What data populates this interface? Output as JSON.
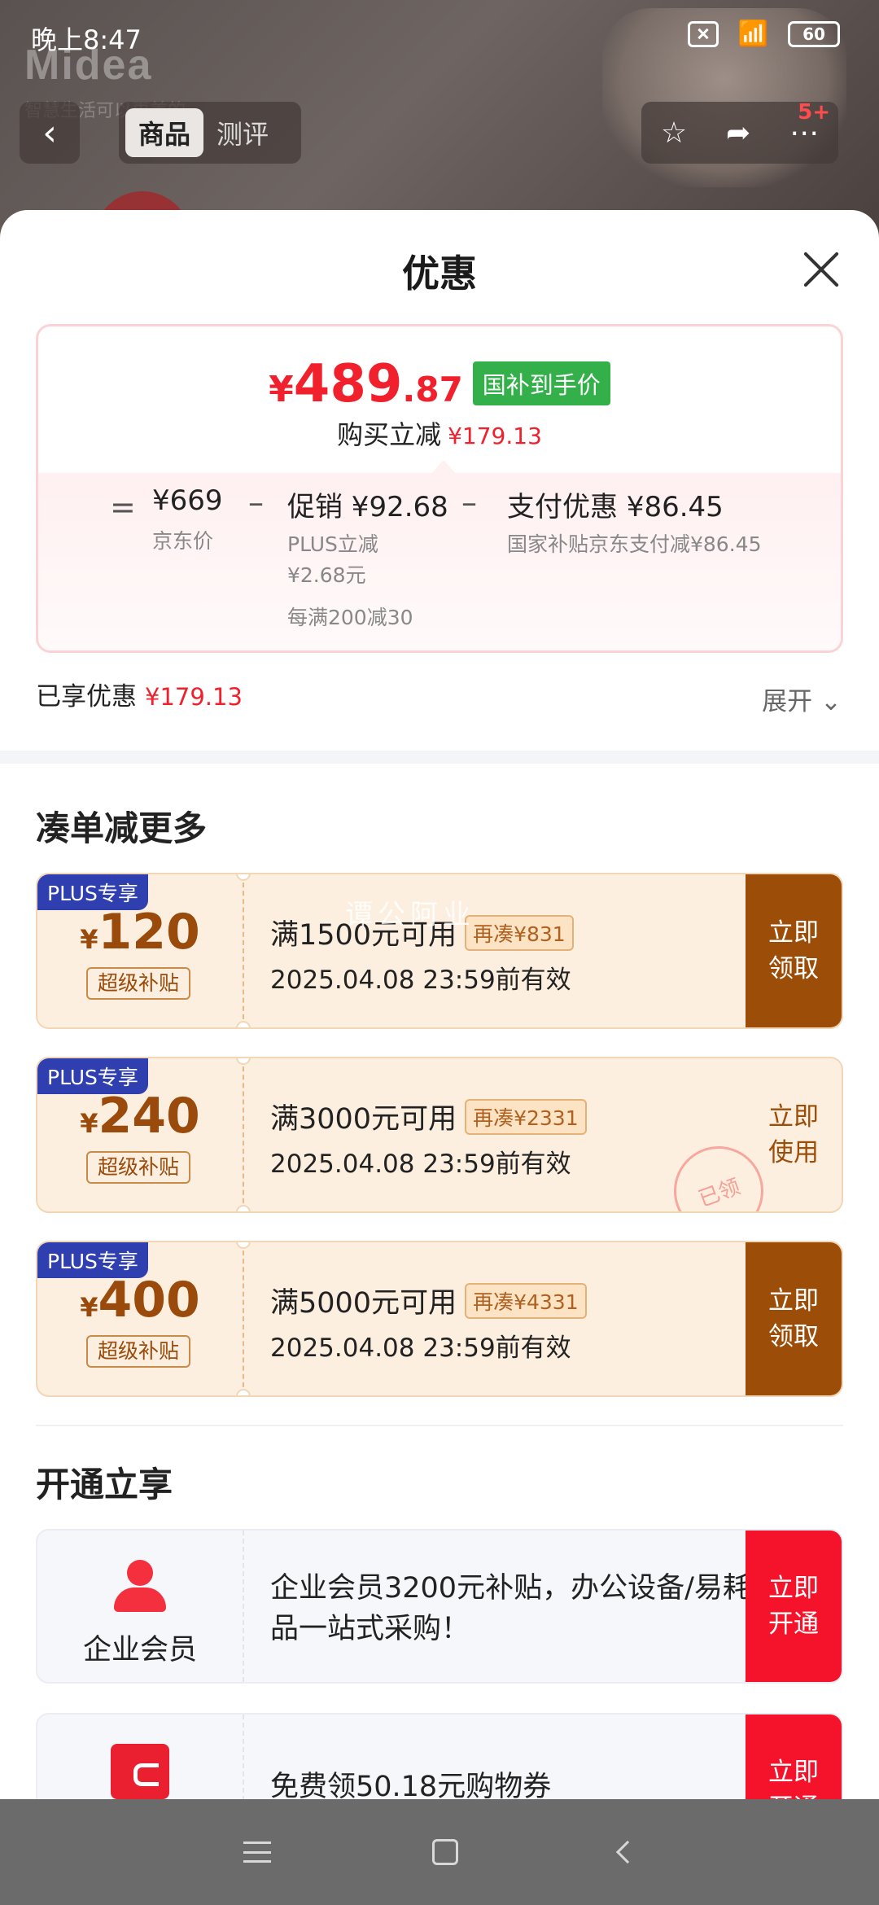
{
  "status_bar": {
    "time": "晚上8:47",
    "battery": "60",
    "wifi_icon": "wifi-icon"
  },
  "background": {
    "brand": "Midea",
    "brand_sub": "智慧生活可以更美的"
  },
  "nav": {
    "tabs": [
      "商品",
      "测评"
    ],
    "active_tab": "商品",
    "badge": "5+"
  },
  "sheet": {
    "title": "优惠",
    "price": {
      "yen": "¥",
      "int": "489",
      "dec": ".87",
      "tag": "国补到手价"
    },
    "save": {
      "label": "购买立减",
      "value": "¥179.13"
    },
    "breakdown": {
      "eq": "=",
      "jd_price": "¥669",
      "jd_price_label": "京东价",
      "minus1": "–",
      "promo": "促销 ¥92.68",
      "promo_sub1": "PLUS立减",
      "promo_sub2": "¥2.68元",
      "promo_sub3": "每满200减30",
      "minus2": "–",
      "pay": "支付优惠 ¥86.45",
      "pay_sub": "国家补贴京东支付减¥86.45"
    },
    "enjoyed": {
      "label": "已享优惠",
      "value": "¥179.13"
    },
    "expand_label": "展开"
  },
  "coupons_section": {
    "title": "凑单减更多",
    "watermark": "谭公阿业",
    "coupons": [
      {
        "tag": "PLUS专享",
        "yen": "¥",
        "amount": "120",
        "subsidy": "超级补贴",
        "condition": "满1500元可用",
        "more": "再凑¥831",
        "valid": "2025.04.08 23:59前有效",
        "action": "立即领取",
        "claimed": false
      },
      {
        "tag": "PLUS专享",
        "yen": "¥",
        "amount": "240",
        "subsidy": "超级补贴",
        "condition": "满3000元可用",
        "more": "再凑¥2331",
        "valid": "2025.04.08 23:59前有效",
        "action": "立即使用",
        "claimed": true,
        "stamp": "已领"
      },
      {
        "tag": "PLUS专享",
        "yen": "¥",
        "amount": "400",
        "subsidy": "超级补贴",
        "condition": "满5000元可用",
        "more": "再凑¥4331",
        "valid": "2025.04.08 23:59前有效",
        "action": "立即领取",
        "claimed": false
      }
    ]
  },
  "open_section": {
    "title": "开通立享",
    "items": [
      {
        "label": "企业会员",
        "desc": "企业会员3200元补贴，办公设备/易耗品一站式采购！",
        "action": "立即开通",
        "icon": "person-icon"
      },
      {
        "label": "",
        "desc": "免费领50.18元购物券",
        "action": "立即开通",
        "icon": "card-icon"
      }
    ]
  },
  "colors": {
    "accent_red": "#f0202c",
    "coupon_brown": "#9c4d08",
    "plus_blue": "#2f3fb0",
    "green_tag": "#34b04a"
  }
}
